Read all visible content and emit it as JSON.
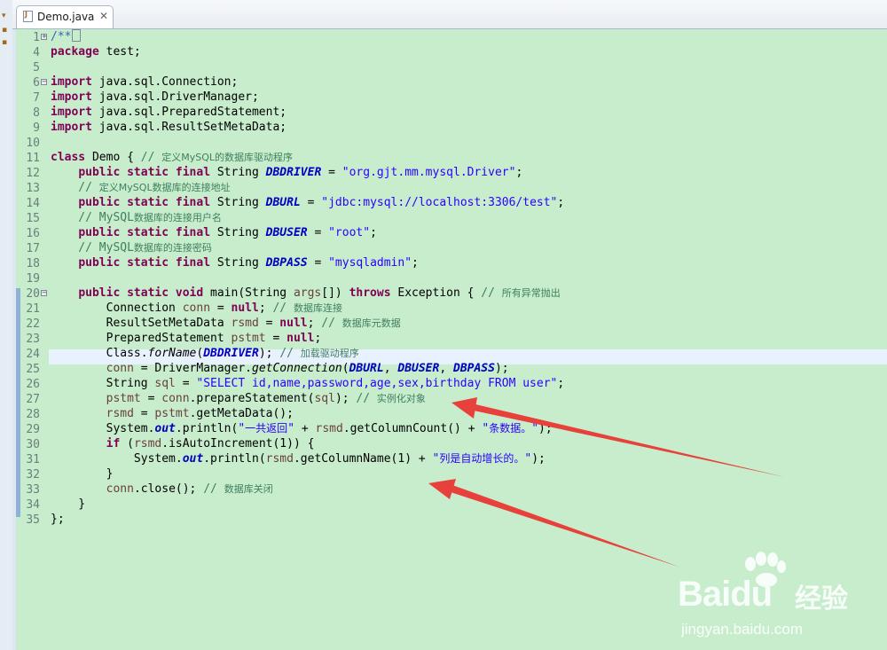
{
  "tab": {
    "title": "Demo.java",
    "close_glyph": "✕"
  },
  "editor": {
    "current_line": "24",
    "lines": [
      {
        "n": "1"
      },
      {
        "n": "4"
      },
      {
        "n": "5"
      },
      {
        "n": "6"
      },
      {
        "n": "7"
      },
      {
        "n": "8"
      },
      {
        "n": "9"
      },
      {
        "n": "10"
      },
      {
        "n": "11"
      },
      {
        "n": "12"
      },
      {
        "n": "13"
      },
      {
        "n": "14"
      },
      {
        "n": "15"
      },
      {
        "n": "16"
      },
      {
        "n": "17"
      },
      {
        "n": "18"
      },
      {
        "n": "19"
      },
      {
        "n": "20"
      },
      {
        "n": "21"
      },
      {
        "n": "22"
      },
      {
        "n": "23"
      },
      {
        "n": "24"
      },
      {
        "n": "25"
      },
      {
        "n": "26"
      },
      {
        "n": "27"
      },
      {
        "n": "28"
      },
      {
        "n": "29"
      },
      {
        "n": "30"
      },
      {
        "n": "31"
      },
      {
        "n": "32"
      },
      {
        "n": "33"
      },
      {
        "n": "34"
      },
      {
        "n": "35"
      }
    ],
    "code": {
      "l1": "/**",
      "l4": [
        "package",
        " test;"
      ],
      "l6": [
        "import",
        " java.sql.Connection;"
      ],
      "l7": [
        "import",
        " java.sql.DriverManager;"
      ],
      "l8": [
        "import",
        " java.sql.PreparedStatement;"
      ],
      "l9": [
        "import",
        " java.sql.ResultSetMetaData;"
      ],
      "l11": [
        "class",
        " Demo { ",
        "// ",
        "定义MySQL的数据库驱动程序"
      ],
      "l12": [
        "    ",
        "public static final",
        " String ",
        "DBDRIVER",
        " = ",
        "\"org.gjt.mm.mysql.Driver\"",
        ";"
      ],
      "l13": [
        "    // ",
        "定义MySQL数据库的连接地址"
      ],
      "l14": [
        "    ",
        "public static final",
        " String ",
        "DBURL",
        " = ",
        "\"jdbc:mysql://localhost:3306/test\"",
        ";"
      ],
      "l15": [
        "    // MySQL",
        "数据库的连接用户名"
      ],
      "l16": [
        "    ",
        "public static final",
        " String ",
        "DBUSER",
        " = ",
        "\"root\"",
        ";"
      ],
      "l17": [
        "    // MySQL",
        "数据库的连接密码"
      ],
      "l18": [
        "    ",
        "public static final",
        " String ",
        "DBPASS",
        " = ",
        "\"mysqladmin\"",
        ";"
      ],
      "l20": [
        "    ",
        "public static void",
        " main(String ",
        "args",
        "[]) ",
        "throws",
        " Exception { ",
        "// ",
        "所有异常抛出"
      ],
      "l21": [
        "        Connection ",
        "conn",
        " = ",
        "null",
        "; ",
        "// ",
        "数据库连接"
      ],
      "l22": [
        "        ResultSetMetaData ",
        "rsmd",
        " = ",
        "null",
        "; ",
        "// ",
        "数据库元数据"
      ],
      "l23": [
        "        PreparedStatement ",
        "pstmt",
        " = ",
        "null",
        ";"
      ],
      "l24": [
        "        Class.",
        "forName",
        "(",
        "DBDRIVER",
        "); ",
        "// ",
        "加载驱动程序"
      ],
      "l25": [
        "        ",
        "conn",
        " = DriverManager.",
        "getConnection",
        "(",
        "DBURL",
        ", ",
        "DBUSER",
        ", ",
        "DBPASS",
        ");"
      ],
      "l26": [
        "        String ",
        "sql",
        " = ",
        "\"SELECT id,name,password,age,sex,birthday FROM user\"",
        ";"
      ],
      "l27": [
        "        ",
        "pstmt",
        " = ",
        "conn",
        ".prepareStatement(",
        "sql",
        "); ",
        "// ",
        "实例化对象"
      ],
      "l28": [
        "        ",
        "rsmd",
        " = ",
        "pstmt",
        ".getMetaData();"
      ],
      "l29": [
        "        System.",
        "out",
        ".println(",
        "\"",
        "一共返回",
        "\"",
        " + ",
        "rsmd",
        ".getColumnCount() + ",
        "\"",
        "条数据。",
        "\"",
        ");"
      ],
      "l30": [
        "        ",
        "if",
        " (",
        "rsmd",
        ".isAutoIncrement(1)) {"
      ],
      "l31": [
        "            System.",
        "out",
        ".println(",
        "rsmd",
        ".getColumnName(1) + ",
        "\"",
        "列是自动增长的。",
        "\"",
        ");"
      ],
      "l32": [
        "        }"
      ],
      "l33": [
        "        ",
        "conn",
        ".close(); ",
        "// ",
        "数据库关闭"
      ],
      "l34": [
        "    }"
      ],
      "l35": [
        "};"
      ]
    }
  },
  "watermark": {
    "logo": "Bai",
    "logo2": "du",
    "cn": "经验",
    "url": "jingyan.baidu.com"
  },
  "colors": {
    "editor_bg": "#c7edcc",
    "arrow": "#e8403a",
    "keyword": "#7f0055",
    "string": "#2a00ff",
    "comment": "#3f7f5f",
    "field": "#0000c0"
  }
}
